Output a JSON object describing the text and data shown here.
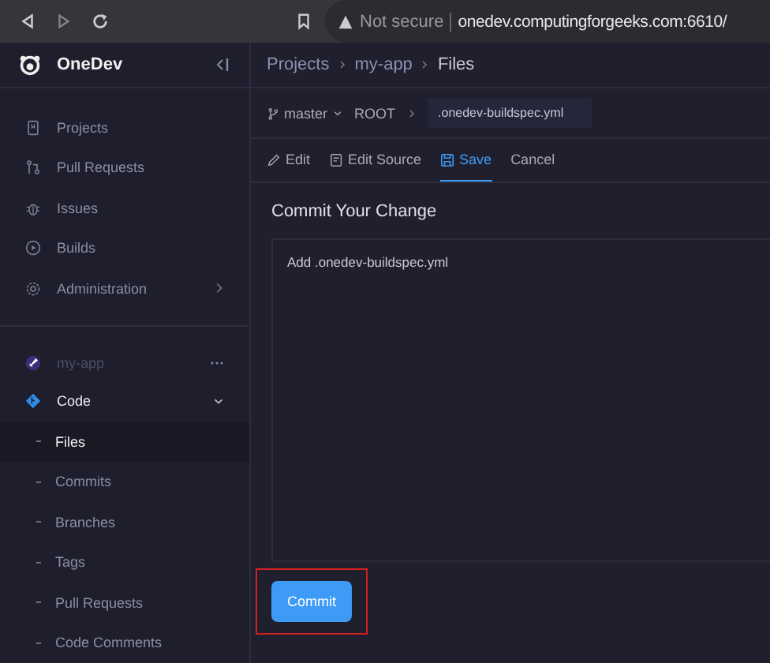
{
  "browser": {
    "security": "Not secure",
    "url": "onedev.computingforgeeks.com:6610/"
  },
  "sidebar": {
    "brand": "OneDev",
    "items": [
      {
        "label": "Projects",
        "has_submenu": false
      },
      {
        "label": "Pull Requests",
        "has_submenu": false
      },
      {
        "label": "Issues",
        "has_submenu": false
      },
      {
        "label": "Builds",
        "has_submenu": false
      },
      {
        "label": "Administration",
        "has_submenu": true
      }
    ],
    "project": "my-app",
    "section": {
      "label": "Code",
      "expanded": true,
      "children": [
        {
          "label": "Files",
          "selected": true
        },
        {
          "label": "Commits",
          "selected": false
        },
        {
          "label": "Branches",
          "selected": false
        },
        {
          "label": "Tags",
          "selected": false
        },
        {
          "label": "Pull Requests",
          "selected": false
        },
        {
          "label": "Code Comments",
          "selected": false
        }
      ]
    }
  },
  "breadcrumb": [
    "Projects",
    "my-app",
    "Files"
  ],
  "path_bar": {
    "branch": "master",
    "root": "ROOT",
    "file_name": ".onedev-buildspec.yml"
  },
  "tabs": [
    {
      "label": "Edit",
      "selected": false
    },
    {
      "label": "Edit Source",
      "selected": false
    },
    {
      "label": "Save",
      "selected": true
    },
    {
      "label": "Cancel",
      "selected": false
    }
  ],
  "commit": {
    "heading": "Commit Your Change",
    "message": "Add .onedev-buildspec.yml",
    "button": "Commit",
    "highlighted": true
  }
}
